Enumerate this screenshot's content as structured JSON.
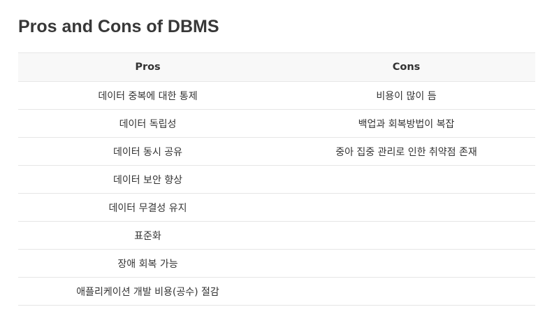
{
  "page": {
    "title": "Pros and Cons of DBMS"
  },
  "table": {
    "headers": [
      "Pros",
      "Cons"
    ],
    "rows": [
      [
        "데이터 중복에 대한 통제",
        "비용이 많이 듬"
      ],
      [
        "데이터 독립성",
        "백업과 회복방법이 복잡"
      ],
      [
        "데이터 동시 공유",
        "중아 집중 관리로 인한 취약점 존재"
      ],
      [
        "데이터 보안 향상",
        ""
      ],
      [
        "데이터 무결성 유지",
        ""
      ],
      [
        "표준화",
        ""
      ],
      [
        "장애 회복 가능",
        ""
      ],
      [
        "애플리케이션 개발 비용(공수) 절감",
        ""
      ]
    ]
  }
}
